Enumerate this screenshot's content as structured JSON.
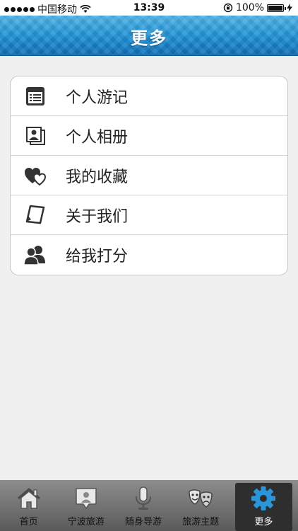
{
  "status_bar": {
    "carrier": "中国移动",
    "time": "13:39",
    "battery": "100%"
  },
  "nav": {
    "title": "更多"
  },
  "menu": {
    "items": [
      {
        "label": "个人游记",
        "icon": "notebook-icon"
      },
      {
        "label": "个人相册",
        "icon": "photo-album-icon"
      },
      {
        "label": "我的收藏",
        "icon": "hearts-icon"
      },
      {
        "label": "关于我们",
        "icon": "document-icon"
      },
      {
        "label": "给我打分",
        "icon": "users-icon"
      }
    ]
  },
  "tabs": {
    "items": [
      {
        "label": "首页",
        "icon": "home-icon"
      },
      {
        "label": "宁波旅游",
        "icon": "map-pin-icon"
      },
      {
        "label": "随身导游",
        "icon": "microphone-icon"
      },
      {
        "label": "旅游主题",
        "icon": "theater-masks-icon"
      },
      {
        "label": "更多",
        "icon": "gear-icon"
      }
    ],
    "active_index": 4
  },
  "colors": {
    "nav_accent": "#1d8fd3",
    "active_tab_icon": "#2a95d8"
  }
}
